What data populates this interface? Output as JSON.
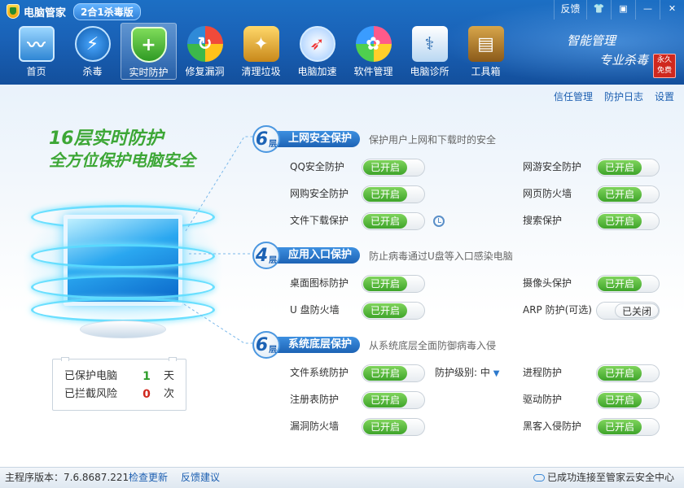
{
  "app": {
    "name": "电脑管家",
    "edition": "2合1杀毒版"
  },
  "window_controls": {
    "feedback": "反馈"
  },
  "toolbar": [
    {
      "id": "home",
      "label": "首页"
    },
    {
      "id": "antivirus",
      "label": "杀毒"
    },
    {
      "id": "realtime",
      "label": "实时防护",
      "active": true
    },
    {
      "id": "repair",
      "label": "修复漏洞"
    },
    {
      "id": "clean",
      "label": "清理垃圾"
    },
    {
      "id": "speedup",
      "label": "电脑加速"
    },
    {
      "id": "software",
      "label": "软件管理"
    },
    {
      "id": "diagnose",
      "label": "电脑诊所"
    },
    {
      "id": "toolbox",
      "label": "工具箱"
    }
  ],
  "slogan": {
    "line1": "智能管理",
    "line2": "专业杀毒"
  },
  "free_badge": {
    "line1": "永久",
    "line2": "免费"
  },
  "sub_links": [
    "信任管理",
    "防护日志",
    "设置"
  ],
  "hero": {
    "line1": "16层实时防护",
    "line2": "全方位保护电脑安全"
  },
  "stats": {
    "protected_label": "已保护电脑",
    "protected_value": "1",
    "protected_unit": "天",
    "blocked_label": "已拦截风险",
    "blocked_value": "0",
    "blocked_unit": "次"
  },
  "sections": [
    {
      "count": "6",
      "count_unit": "层",
      "title": "上网安全保护",
      "desc": "保护用户上网和下载时的安全",
      "items": [
        {
          "name": "QQ安全防护",
          "state": "已开启",
          "on": true
        },
        {
          "name": "网游安全防护",
          "state": "已开启",
          "on": true
        },
        {
          "name": "网购安全防护",
          "state": "已开启",
          "on": true
        },
        {
          "name": "网页防火墙",
          "state": "已开启",
          "on": true
        },
        {
          "name": "文件下载保护",
          "state": "已开启",
          "on": true
        },
        {
          "name": "搜索保护",
          "state": "已开启",
          "on": true
        }
      ]
    },
    {
      "count": "4",
      "count_unit": "层",
      "title": "应用入口保护",
      "desc": "防止病毒通过U盘等入口感染电脑",
      "items": [
        {
          "name": "桌面图标防护",
          "state": "已开启",
          "on": true
        },
        {
          "name": "摄像头保护",
          "state": "已开启",
          "on": true
        },
        {
          "name": "U 盘防火墙",
          "state": "已开启",
          "on": true
        },
        {
          "name": "ARP 防护(可选)",
          "state": "已关闭",
          "on": false
        }
      ]
    },
    {
      "count": "6",
      "count_unit": "层",
      "title": "系统底层保护",
      "desc": "从系统底层全面防御病毒入侵",
      "items": [
        {
          "name": "文件系统防护",
          "state": "已开启",
          "on": true
        },
        {
          "name": "进程防护",
          "state": "已开启",
          "on": true
        },
        {
          "name": "注册表防护",
          "state": "已开启",
          "on": true
        },
        {
          "name": "驱动防护",
          "state": "已开启",
          "on": true
        },
        {
          "name": "漏洞防火墙",
          "state": "已开启",
          "on": true
        },
        {
          "name": "黑客入侵防护",
          "state": "已开启",
          "on": true
        }
      ],
      "level_label": "防护级别:",
      "level_value": "中"
    }
  ],
  "statusbar": {
    "version": "主程序版本：7.6.8687.221",
    "check_update": "检查更新",
    "feedback": "反馈建议",
    "cloud_status": "已成功连接至管家云安全中心"
  }
}
